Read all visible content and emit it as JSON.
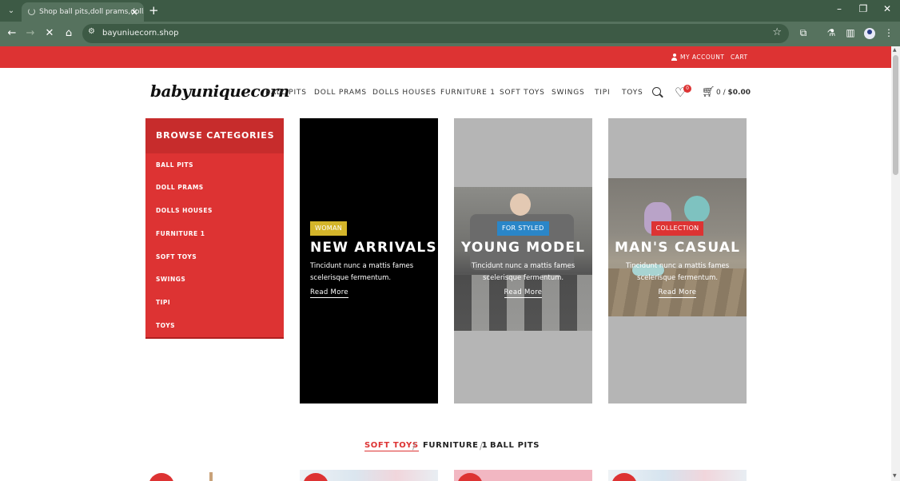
{
  "browser": {
    "tab_title": "Shop ball pits,doll prams,dolls h",
    "url": "bayuniuecorn.shop"
  },
  "topbar": {
    "account_label": "MY ACCOUNT",
    "cart_label": "CART"
  },
  "header": {
    "logo_text": "babyuniquecorn",
    "nav": [
      "BALL PITS",
      "DOLL PRAMS",
      "DOLLS HOUSES",
      "FURNITURE 1",
      "SOFT TOYS",
      "SWINGS",
      "TIPI",
      "TOYS"
    ],
    "wishlist_count": "0",
    "cart_count": "0",
    "cart_sep": "/",
    "cart_total": "$0.00"
  },
  "browse": {
    "title": "BROWSE CATEGORIES",
    "items": [
      "BALL PITS",
      "DOLL PRAMS",
      "DOLLS HOUSES",
      "FURNITURE 1",
      "SOFT TOYS",
      "SWINGS",
      "TIPI",
      "TOYS"
    ]
  },
  "banners": [
    {
      "tag": "WOMAN",
      "tag_color": "#d4b52a",
      "title": "NEW ARRIVALS",
      "desc1": "Tincidunt nunc a mattis fames",
      "desc2": "scelerisque fermentum.",
      "link": "Read More"
    },
    {
      "tag": "FOR STYLED",
      "tag_color": "#2a86c8",
      "title": "YOUNG MODEL",
      "desc1": "Tincidunt nunc a mattis fames",
      "desc2": "scelerisque fermentum.",
      "link": "Read More"
    },
    {
      "tag": "COLLECTION",
      "tag_color": "#dd3333",
      "title": "MAN'S CASUAL",
      "desc1": "Tincidunt nunc a mattis fames",
      "desc2": "scelerisque fermentum.",
      "link": "Read More"
    }
  ],
  "product_tabs": {
    "items": [
      "SOFT TOYS",
      "FURNITURE 1",
      "BALL PITS"
    ],
    "separator": "/"
  },
  "colors": {
    "accent": "#dd3333",
    "chrome": "#56725e"
  }
}
